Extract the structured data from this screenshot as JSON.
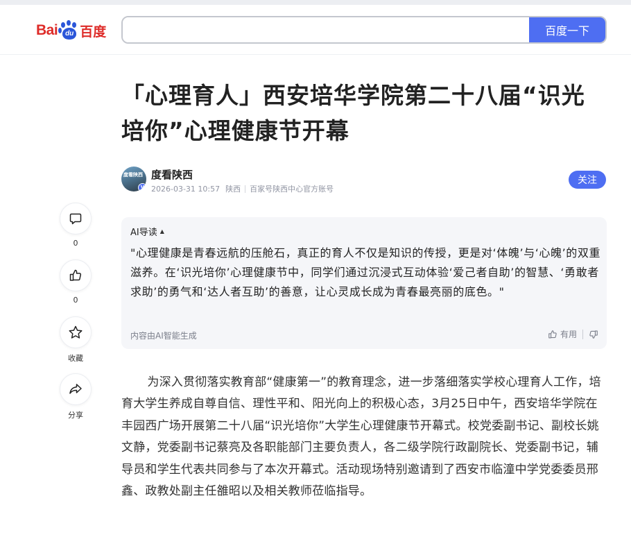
{
  "header": {
    "logo_bai": "Bai",
    "logo_du": "du",
    "logo_cn": "百度",
    "search_placeholder": "",
    "search_button": "百度一下"
  },
  "article": {
    "title": "「心理育人」西安培华学院第二十八届“识光培你”心理健康节开幕",
    "author": {
      "avatar_text": "度看陕西",
      "name": "度看陕西",
      "datetime": "2026-03-31 10:57",
      "location": "陕西",
      "account": "百家号陕西中心官方账号",
      "follow_label": "关注"
    },
    "body": "为深入贯彻落实教育部“健康第一”的教育理念，进一步落细落实学校心理育人工作，培育大学生养成自尊自信、理性平和、阳光向上的积极心态，3月25日中午，西安培华学院在丰园西广场开展第二十八届“识光培你”大学生心理健康节开幕式。校党委副书记、副校长姚文静，党委副书记蔡亮及各职能部门主要负责人，各二级学院行政副院长、党委副书记，辅导员和学生代表共同参与了本次开幕式。活动现场特别邀请到了西安市临潼中学党委委员邢鑫、政教处副主任雒昭以及相关教师莅临指导。"
  },
  "rail": {
    "comment_count": "0",
    "like_count": "0",
    "favorite_label": "收藏",
    "share_label": "分享"
  },
  "ai_summary": {
    "heading": "AI导读",
    "text": "\"心理健康是青春远航的压舱石，真正的育人不仅是知识的传授，更是对‘体魄’与‘心魄’的双重滋养。在‘识光培你’心理健康节中，同学们通过沉浸式互动体验‘爱己者自助’的智慧、‘勇敢者求助’的勇气和‘达人者互助’的善意，让心灵成长成为青春最亮丽的底色。\"",
    "footer": "内容由AI智能生成",
    "useful_label": "有用"
  },
  "colors": {
    "brand_blue": "#4e6ef2",
    "brand_red": "#de2c29"
  }
}
